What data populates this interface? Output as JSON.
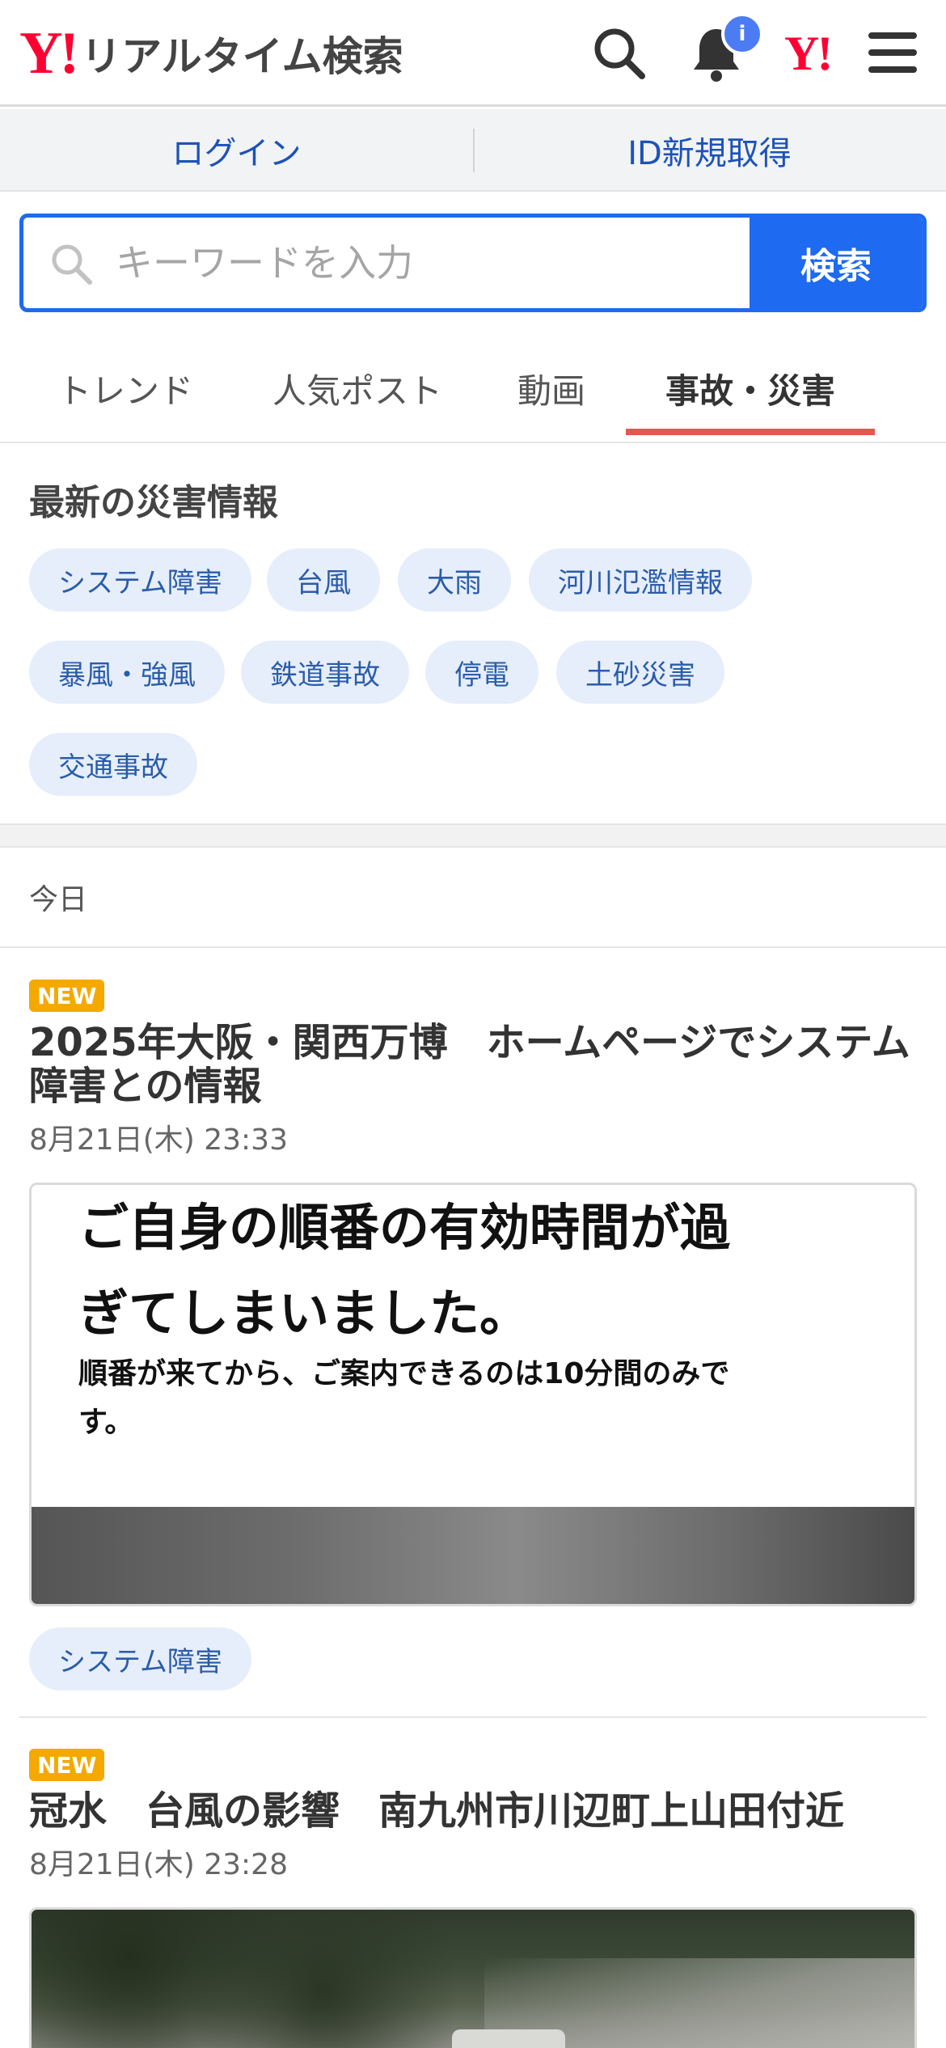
{
  "header": {
    "logo_mark": "Y!",
    "logo_text": "リアルタイム検索",
    "notification_badge": "i",
    "yahoo_mark": "Y!",
    "icons": [
      "search-icon",
      "bell-icon",
      "menu-icon"
    ]
  },
  "login_bar": {
    "login_label": "ログイン",
    "register_label": "ID新規取得"
  },
  "search": {
    "placeholder": "キーワードを入力",
    "button_label": "検索"
  },
  "tabs": [
    {
      "label": "トレンド",
      "active": false
    },
    {
      "label": "人気ポスト",
      "active": false
    },
    {
      "label": "動画",
      "active": false
    },
    {
      "label": "事故・災害",
      "active": true
    }
  ],
  "disaster": {
    "title": "最新の災害情報",
    "chips": [
      "システム障害",
      "台風",
      "大雨",
      "河川氾濫情報",
      "暴風・強風",
      "鉄道事故",
      "停電",
      "土砂災害",
      "交通事故"
    ]
  },
  "date_group": "今日",
  "articles": [
    {
      "badge": "NEW",
      "title": "2025年大阪・関西万博　ホームページでシステム障害との情報",
      "time": "8月21日(木) 23:33",
      "image_text": {
        "line1": "ご自身の順番の有効時間が過",
        "line2": "ぎてしまいました。",
        "sub1": "順番が来てから、ご案内できるのは10分間のみで",
        "sub2": "す。"
      },
      "tag": "システム障害"
    },
    {
      "badge": "NEW",
      "title": "冠水　台風の影響　南九州市川辺町上山田付近",
      "time": "8月21日(木) 23:28"
    }
  ],
  "colors": {
    "brand_red": "#ff0033",
    "accent_blue": "#1e6af0",
    "tab_underline": "#e05a4f",
    "new_badge": "#f5a800",
    "chip_bg": "#e6eefb",
    "chip_text": "#2a5caa"
  }
}
